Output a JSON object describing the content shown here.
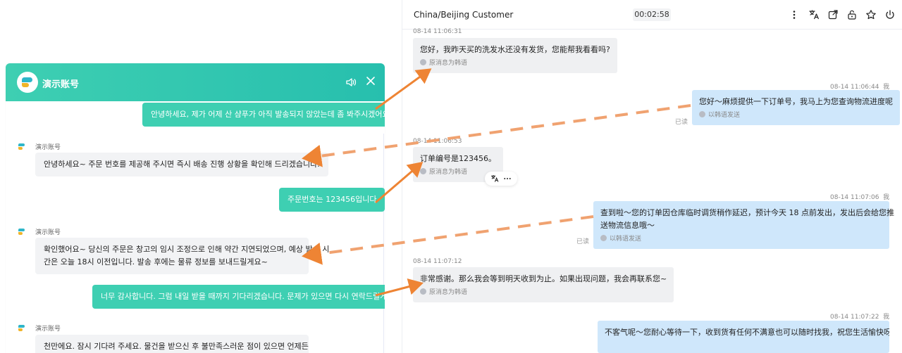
{
  "widget": {
    "title": "演示账号",
    "sender_name": "演示账号",
    "messages": [
      {
        "dir": "out",
        "text": "안녕하세요, 제가 어제 산 샴푸가 아직 발송되지 않았는데 좀 봐주시겠어요?"
      },
      {
        "dir": "in",
        "text": "안녕하세요~ 주문 번호를 제공해 주시면 즉시 배송 진행 상황을 확인해 드리겠습니다."
      },
      {
        "dir": "out",
        "text": "주문번호는 123456입니다"
      },
      {
        "dir": "in",
        "line1": "확인했어요~ 당신의 주문은 창고의 임시 조정으로 인해 약간 지연되었으며, 예상 발송 시",
        "line2": "간은 오늘 18시 이전입니다. 발송 후에는 물류 정보를 보내드릴게요~"
      },
      {
        "dir": "out",
        "text": "너무 감사합니다. 그럼 내일 받을 때까지 기다리겠습니다. 문제가 있으면 다시 연락드릴게요~"
      },
      {
        "dir": "in",
        "text": "천만에요. 잠시 기다려 주세요. 물건을 받으신 후 불만족스러운 점이 있으면 언제든지 저"
      }
    ]
  },
  "panel": {
    "title": "China/Beijing Customer",
    "timer": "00:02:58",
    "me_label": "我",
    "read_label": "已读",
    "in_sub": "原消息为韩语",
    "out_sub": "以韩语发送",
    "messages": [
      {
        "dir": "in",
        "ts": "08-14 11:06:31",
        "text": "您好，我昨天买的洗发水还没有发货，您能帮我看看吗?"
      },
      {
        "dir": "out",
        "ts": "08-14 11:06:44",
        "text": "您好～麻烦提供一下订单号，我马上为您查询物流进度呢"
      },
      {
        "dir": "in",
        "ts": "08-14 11:06:53",
        "text": "订单编号是123456。"
      },
      {
        "dir": "out",
        "ts": "08-14 11:07:06",
        "line1": "查到啦～您的订单因仓库临时调货稍作延迟，预计今天 18 点前发出，发出后会给您推",
        "line2": "送物流信息哦～"
      },
      {
        "dir": "in",
        "ts": "08-14 11:07:12",
        "text": "非常感谢。那么我会等到明天收到为止。如果出现问题，我会再联系您~"
      },
      {
        "dir": "out",
        "ts": "08-14 11:07:22",
        "text": "不客气呢～您耐心等待一下，收到货有任何不满意也可以随时找我，祝您生活愉快呀～"
      }
    ]
  },
  "colors": {
    "widget_accent": "#3ecfb2",
    "out_bubble": "#cfe7fb",
    "in_bubble": "#eff0f2",
    "arrow": "#ee8434"
  }
}
